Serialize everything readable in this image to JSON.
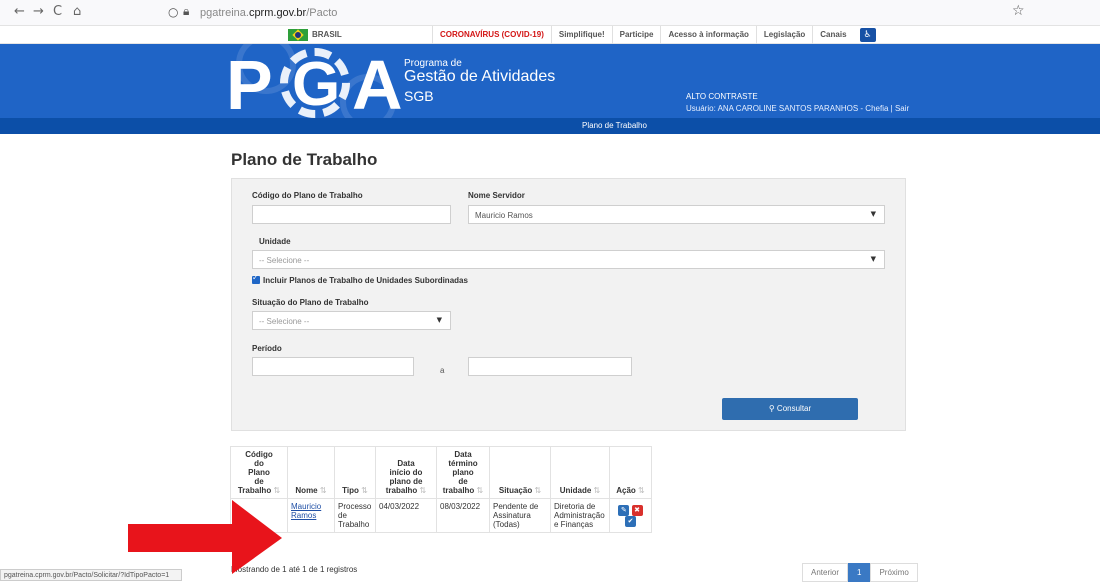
{
  "browser": {
    "back": "←",
    "forward": "→",
    "reload": "C",
    "home": "⌂",
    "url_prefix": "pgatreina.",
    "url_domain": "cprm.gov.br",
    "url_path": "/Pacto",
    "bookmark": "☆"
  },
  "govbar": {
    "brasil": "BRASIL",
    "links": [
      "CORONAVÍRUS (COVID-19)",
      "Simplifique!",
      "Participe",
      "Acesso à informação",
      "Legislação",
      "Canais"
    ]
  },
  "header": {
    "logo_letters": [
      "P",
      "G",
      "A"
    ],
    "programa": "Programa de",
    "gestao": "Gestão de Atividades",
    "sgb": "SGB",
    "alto_contraste": "ALTO CONTRASTE",
    "usuario": "Usuário: ANA CAROLINE SANTOS PARANHOS   - Chefia | Sair"
  },
  "nav": {
    "current": "Plano de Trabalho"
  },
  "page": {
    "title": "Plano de Trabalho"
  },
  "filters": {
    "codigo_label": "Código do Plano de Trabalho",
    "codigo_value": "",
    "nome_label": "Nome Servidor",
    "nome_value": "Mauricio Ramos",
    "unidade_label": "Unidade",
    "unidade_value": "-- Selecione --",
    "incluir_label": "Incluir Planos de Trabalho de Unidades Subordinadas",
    "situacao_label": "Situação do Plano de Trabalho",
    "situacao_value": "-- Selecione --",
    "periodo_label": "Período",
    "periodo_sep": "a",
    "consultar": "Consultar"
  },
  "table": {
    "headers": [
      [
        "Código",
        "do",
        "Plano",
        "de",
        "Trabalho"
      ],
      [
        "Nome"
      ],
      [
        "Tipo"
      ],
      [
        "Data",
        "início do",
        "plano de",
        "trabalho"
      ],
      [
        "Data",
        "término",
        "plano",
        "de",
        "trabalho"
      ],
      [
        "Situação"
      ],
      [
        "Unidade"
      ],
      [
        "Ação"
      ]
    ],
    "row": {
      "codigo": "",
      "nome": [
        "Mauricio",
        "Ramos"
      ],
      "tipo": [
        "Processo",
        "de",
        "Trabalho"
      ],
      "inicio": "04/03/2022",
      "termino": "08/03/2022",
      "situacao": [
        "Pendente de",
        "Assinatura",
        "(Todas)"
      ],
      "unidade": [
        "Diretoria de",
        "Administração",
        "e Finanças"
      ]
    }
  },
  "footer": {
    "mostrando": "Mostrando de 1 até 1 de 1 registros",
    "anterior": "Anterior",
    "page": "1",
    "proximo": "Próximo",
    "status_url": "pgatreina.cprm.gov.br/Pacto/Solicitar/?IdTipoPacto=1"
  },
  "colors": {
    "header_blue": "#1f64c6",
    "nav_blue": "#0c4fa8",
    "arrow_red": "#e8141b"
  }
}
